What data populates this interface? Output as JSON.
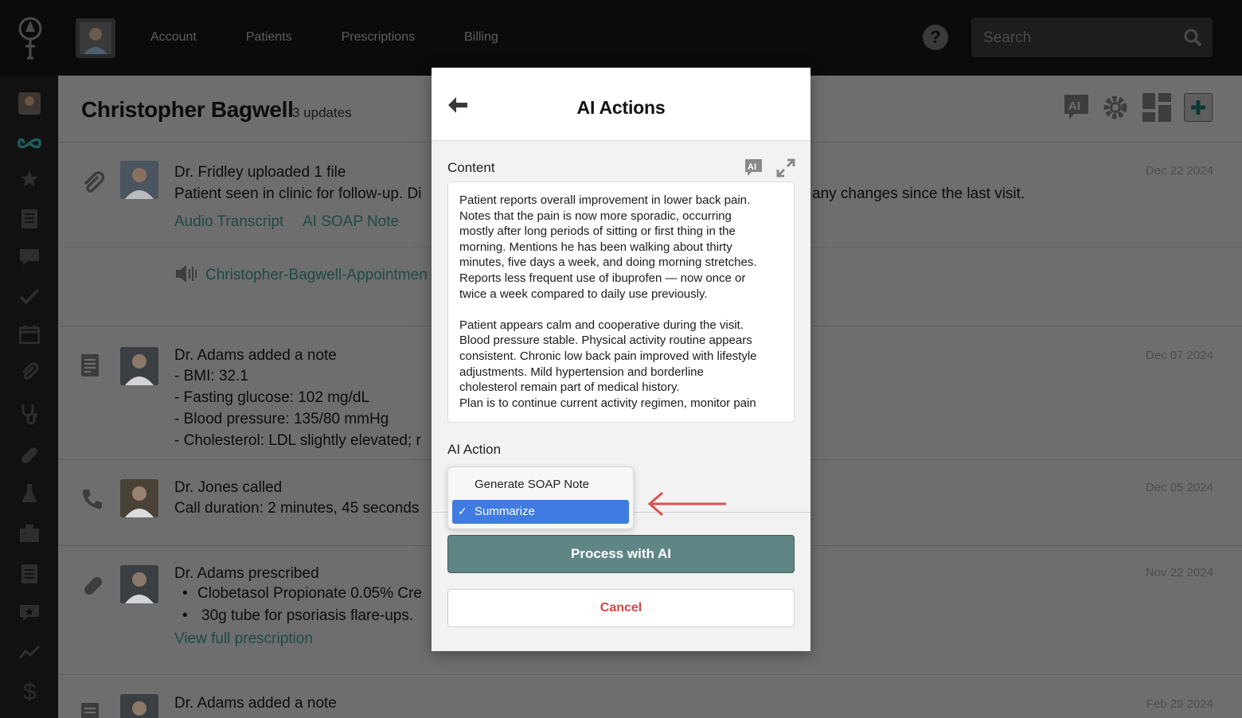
{
  "topbar": {
    "nav": [
      "Account",
      "Patients",
      "Prescriptions",
      "Billing"
    ],
    "help_label": "?",
    "search_placeholder": "Search"
  },
  "page": {
    "title": "Christopher Bagwell",
    "updates": "3 updates"
  },
  "feed": [
    {
      "title": "Dr. Fridley uploaded 1 file",
      "body": "Patient seen in clinic for follow-up. Di",
      "body_tail": "any changes since the last visit.",
      "date": "Dec 22 2024",
      "links": [
        "Audio Transcript",
        "AI SOAP Note"
      ],
      "file": "Christopher-Bagwell-Appointmen",
      "icon": "paperclip-icon"
    },
    {
      "title": "Dr. Adams added a note",
      "lines": [
        "- BMI: 32.1",
        "- Fasting glucose: 102 mg/dL",
        "- Blood pressure: 135/80 mmHg",
        "- Cholesterol: LDL slightly elevated; r"
      ],
      "date": "Dec 07 2024",
      "icon": "note-icon"
    },
    {
      "title": "Dr. Jones called",
      "body": "Call duration: 2 minutes, 45 seconds",
      "date": "Dec 05 2024",
      "icon": "phone-icon"
    },
    {
      "title": "Dr. Adams prescribed",
      "bullets": [
        "Clobetasol Propionate 0.05% Cre",
        "30g tube for psoriasis flare-ups."
      ],
      "link": "View full prescription",
      "date": "Nov 22 2024",
      "icon": "pill-icon"
    },
    {
      "title": "Dr. Adams added a note",
      "date": "Feb 29 2024",
      "icon": "note-icon"
    }
  ],
  "modal": {
    "title": "AI Actions",
    "content_label": "Content",
    "content_text": "Patient reports overall improvement in lower back pain.\nNotes that the pain is now more sporadic, occurring\nmostly after long periods of sitting or first thing in the\nmorning. Mentions he has been walking about thirty\nminutes, five days a week, and doing morning stretches.\nReports less frequent use of ibuprofen — now once or\ntwice a week compared to daily use previously.\n\nPatient appears calm and cooperative during the visit.\nBlood pressure stable. Physical activity routine appears\nconsistent. Chronic low back pain improved with lifestyle\nadjustments. Mild hypertension and borderline\ncholesterol remain part of medical history.\nPlan is to continue current activity regimen, monitor pain",
    "ai_mini_label": "AI",
    "ai_action_label": "AI Action",
    "options": [
      "Generate SOAP Note",
      "Summarize"
    ],
    "selected": "Summarize",
    "check": "✓",
    "process_label": "Process with AI",
    "cancel_label": "Cancel"
  },
  "colors": {
    "accent": "#5f8584",
    "selected": "#3f7be1",
    "cancel": "#d14545",
    "arrow": "#d9534f"
  }
}
